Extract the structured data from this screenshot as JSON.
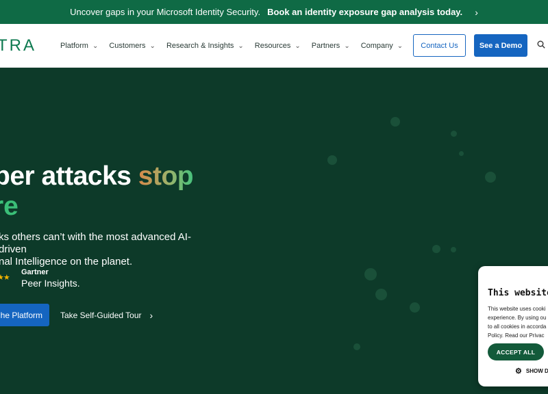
{
  "announcement": {
    "text": "Uncover gaps in your Microsoft Identity Security.",
    "cta": "Book an identity exposure gap analysis today."
  },
  "nav": {
    "logo": "TRA",
    "items": [
      {
        "label": "Platform"
      },
      {
        "label": "Customers"
      },
      {
        "label": "Research & Insights"
      },
      {
        "label": "Resources"
      },
      {
        "label": "Partners"
      },
      {
        "label": "Company"
      }
    ],
    "contact_label": "Contact Us",
    "demo_label": "See a Demo",
    "search_icon": "search-icon"
  },
  "hero": {
    "headline_part1": "ber attacks ",
    "headline_accent": "stop",
    "headline_line2": "re",
    "subline1": "ks others can’t with the most advanced AI-driven",
    "subline2": "nal Intelligence on the planet.",
    "rating_stars": "★★",
    "gartner_label": "Gartner",
    "peer_insights_label": "Peer Insights.",
    "primary_cta": "he Platform",
    "secondary_cta": "Take Self-Guided Tour"
  },
  "cookie": {
    "title": "This website us",
    "body_lines": [
      "This website uses cooki",
      "experience. By using ou",
      "to all cookies in accorda",
      "Policy. Read our Privac"
    ],
    "accept_label": "ACCEPT ALL",
    "show_label": "SHOW D"
  },
  "colors": {
    "announce_bg": "#0f6a45",
    "hero_bg": "#0d3a29",
    "accent_blue": "#1565c0",
    "accent_green": "#3bbf78"
  }
}
